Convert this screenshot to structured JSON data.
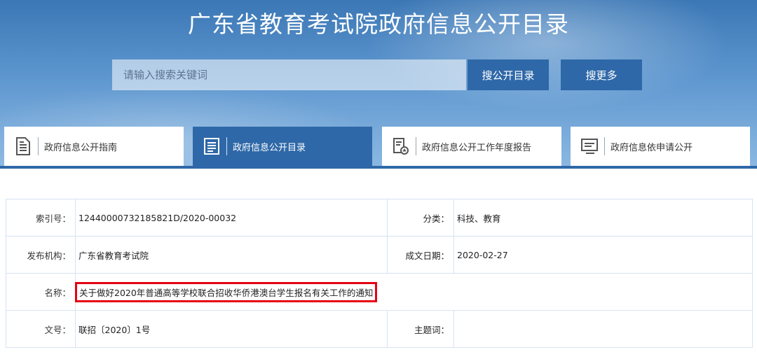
{
  "header": {
    "title": "广东省教育考试院政府信息公开目录",
    "search_placeholder": "请输入搜索关键词",
    "btn_catalog": "搜公开目录",
    "btn_more": "搜更多"
  },
  "tabs": [
    {
      "label": "政府信息公开指南",
      "icon": "document-list-icon"
    },
    {
      "label": "政府信息公开目录",
      "icon": "catalog-icon",
      "active": true
    },
    {
      "label": "政府信息公开工作年度报告",
      "icon": "report-badge-icon"
    },
    {
      "label": "政府信息依申请公开",
      "icon": "application-form-icon"
    }
  ],
  "meta": {
    "index_label": "索引号：",
    "index_value": "12440000732185821D/2020-00032",
    "category_label": "分类：",
    "category_value": "科技、教育",
    "publisher_label": "发布机构：",
    "publisher_value": "广东省教育考试院",
    "date_label": "成文日期：",
    "date_value": "2020-02-27",
    "name_label": "名称：",
    "name_value": "关于做好2020年普通高等学校联合招收华侨港澳台学生报名有关工作的通知",
    "doc_no_label": "文号：",
    "doc_no_value": "联招〔2020〕1号",
    "subject_label": "主题词：",
    "subject_value": ""
  },
  "colors": {
    "primary": "#2e68a8",
    "highlight": "#e60012",
    "border": "#d6e3f2"
  }
}
